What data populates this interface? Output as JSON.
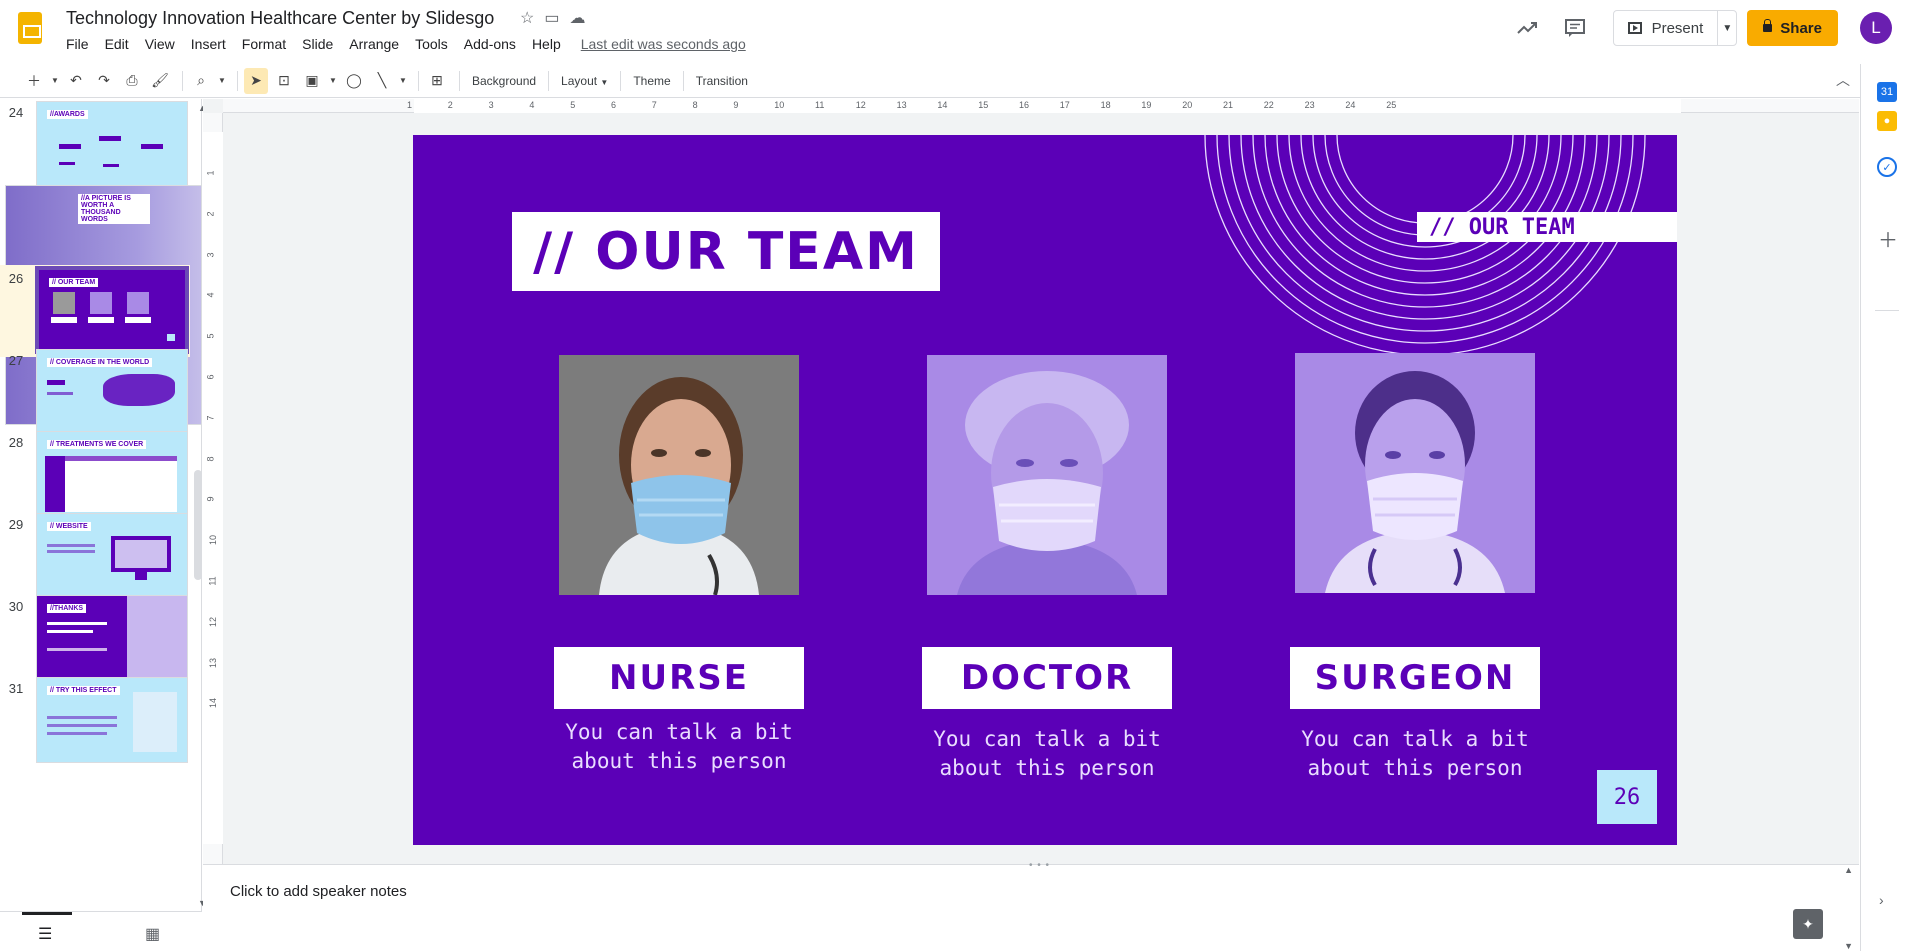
{
  "app": {
    "doc_title": "Technology Innovation Healthcare Center by Slidesgo",
    "last_edit": "Last edit was seconds ago",
    "menu": [
      "File",
      "Edit",
      "View",
      "Insert",
      "Format",
      "Slide",
      "Arrange",
      "Tools",
      "Add-ons",
      "Help"
    ],
    "present_label": "Present",
    "share_label": "Share",
    "avatar_initial": "L"
  },
  "toolbar": {
    "background_label": "Background",
    "layout_label": "Layout",
    "theme_label": "Theme",
    "transition_label": "Transition"
  },
  "filmstrip": {
    "slides": [
      {
        "num": "24",
        "title": "//AWARDS"
      },
      {
        "num": "25",
        "title": "//A PICTURE IS WORTH A THOUSAND WORDS"
      },
      {
        "num": "26",
        "title": "// OUR TEAM"
      },
      {
        "num": "27",
        "title": "// COVERAGE IN THE WORLD"
      },
      {
        "num": "28",
        "title": "// TREATMENTS WE COVER"
      },
      {
        "num": "29",
        "title": "// WEBSITE"
      },
      {
        "num": "30",
        "title": "//THANKS"
      },
      {
        "num": "31",
        "title": "// TRY THIS EFFECT"
      }
    ],
    "active_slide": "26"
  },
  "rulers": {
    "top": [
      "1",
      "2",
      "3",
      "4",
      "5",
      "6",
      "7",
      "8",
      "9",
      "10",
      "11",
      "12",
      "13",
      "14",
      "15",
      "16",
      "17",
      "18",
      "19",
      "20",
      "21",
      "22",
      "23",
      "24",
      "25"
    ],
    "left": [
      "1",
      "2",
      "3",
      "4",
      "5",
      "6",
      "7",
      "8",
      "9",
      "10",
      "11",
      "12",
      "13",
      "14"
    ]
  },
  "slide": {
    "title": "// OUR TEAM",
    "corner_title": "// OUR TEAM",
    "members": [
      {
        "role": "NURSE",
        "description": "You can talk a bit about this person"
      },
      {
        "role": "DOCTOR",
        "description": "You can talk a bit about this person"
      },
      {
        "role": "SURGEON",
        "description": "You can talk a bit about this person"
      }
    ],
    "page_number": "26",
    "colors": {
      "background": "#5b00b7",
      "accent_light": "#b9e8fa",
      "text_light": "#e9ddff"
    }
  },
  "notes": {
    "placeholder": "Click to add speaker notes"
  }
}
